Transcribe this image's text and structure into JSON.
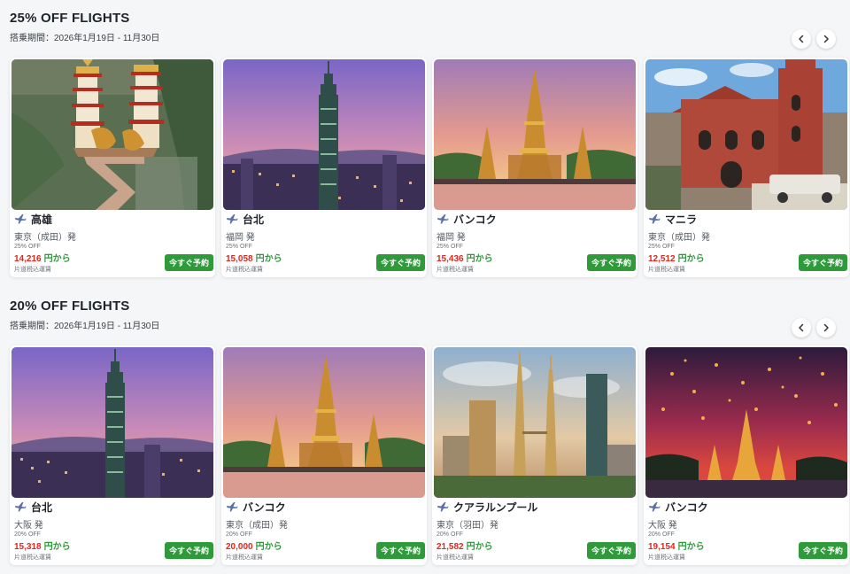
{
  "sections": [
    {
      "title": "25% OFF FLIGHTS",
      "period": "搭乗期間：2026年1月19日 - 11月30日",
      "cards": [
        {
          "destination": "高雄",
          "origin": "東京（成田）発",
          "discount": "25% OFF",
          "price": "14,216",
          "price_suffix": "円から",
          "fare_note": "片道税込運賃",
          "button": "今すぐ予約",
          "image": "kaohsiung-pagodas"
        },
        {
          "destination": "台北",
          "origin": "福岡 発",
          "discount": "25% OFF",
          "price": "15,058",
          "price_suffix": "円から",
          "fare_note": "片道税込運賃",
          "button": "今すぐ予約",
          "image": "taipei-101"
        },
        {
          "destination": "バンコク",
          "origin": "福岡 発",
          "discount": "25% OFF",
          "price": "15,436",
          "price_suffix": "円から",
          "fare_note": "片道税込運賃",
          "button": "今すぐ予約",
          "image": "bangkok-temple"
        },
        {
          "destination": "マニラ",
          "origin": "東京（成田）発",
          "discount": "25% OFF",
          "price": "12,512",
          "price_suffix": "円から",
          "fare_note": "片道税込運賃",
          "button": "今すぐ予約",
          "image": "manila-church"
        }
      ]
    },
    {
      "title": "20% OFF FLIGHTS",
      "period": "搭乗期間：2026年1月19日 - 11月30日",
      "cards": [
        {
          "destination": "台北",
          "origin": "大阪 発",
          "discount": "20% OFF",
          "price": "15,318",
          "price_suffix": "円から",
          "fare_note": "片道税込運賃",
          "button": "今すぐ予約",
          "image": "taipei-101"
        },
        {
          "destination": "バンコク",
          "origin": "東京（成田）発",
          "discount": "20% OFF",
          "price": "20,000",
          "price_suffix": "円から",
          "fare_note": "片道税込運賃",
          "button": "今すぐ予約",
          "image": "bangkok-temple"
        },
        {
          "destination": "クアラルンプール",
          "origin": "東京（羽田）発",
          "discount": "20% OFF",
          "price": "21,582",
          "price_suffix": "円から",
          "fare_note": "片道税込運賃",
          "button": "今すぐ予約",
          "image": "kuala-lumpur-towers"
        },
        {
          "destination": "バンコク",
          "origin": "大阪 発",
          "discount": "20% OFF",
          "price": "19,154",
          "price_suffix": "円から",
          "fare_note": "片道税込運賃",
          "button": "今すぐ予約",
          "image": "bangkok-lanterns"
        }
      ]
    }
  ],
  "colors": {
    "price": "#e0261e",
    "price_suffix": "#2e9a3a",
    "button": "#2e9a3a",
    "plane_icon": "#5b6fae"
  },
  "icons": {
    "destination": "airplane-icon",
    "prev": "chevron-left-icon",
    "next": "chevron-right-icon"
  }
}
